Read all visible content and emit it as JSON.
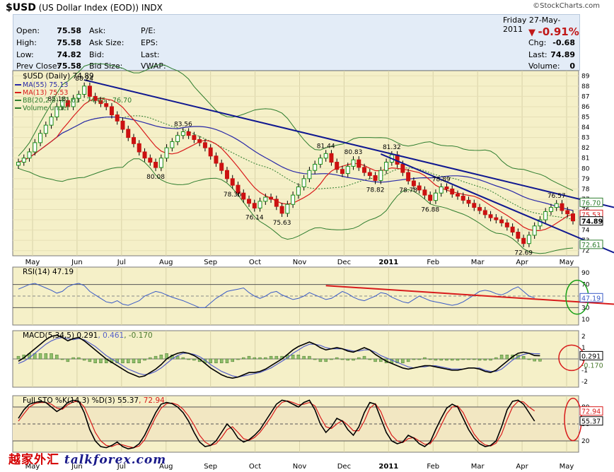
{
  "header": {
    "symbol": "$USD",
    "name": "(US Dollar Index (EOD))",
    "exchange": "INDX",
    "brand": "©StockCharts.com",
    "date": "Friday   27-May-2011",
    "change_pct": "-0.91%",
    "change_arrow": "down-triangle-icon"
  },
  "quote": {
    "left": [
      {
        "label": "Open:",
        "value": "75.58"
      },
      {
        "label": "High:",
        "value": "75.58"
      },
      {
        "label": "Low:",
        "value": "74.82"
      },
      {
        "label": "Prev Close:",
        "value": "75.58"
      }
    ],
    "mid": [
      "Ask:",
      "Ask Size:",
      "Bid:",
      "Bid Size:"
    ],
    "right_labels": [
      "P/E:",
      "EPS:",
      "Last:",
      "VWAP:"
    ],
    "far_right": [
      {
        "label": "Chg:",
        "value": "-0.68"
      },
      {
        "label": "Last:",
        "value": "74.89"
      },
      {
        "label": "Volume:",
        "value": "0"
      }
    ]
  },
  "watermark": {
    "cn": "越家外汇",
    "site": "talkforex.com"
  },
  "colors": {
    "up": "#1a8f1a",
    "down": "#cc1111",
    "ma55": "#2a2aa8",
    "ma13": "#d81b1b",
    "bb": "#2e7d2e",
    "panel": "#f5f0c8",
    "trend": "#101890",
    "rsi": "#3a5bc7"
  },
  "chart_data": [
    {
      "type": "candlestick",
      "title": "$USD (Daily) 74.89",
      "legend": [
        "MA(55) 75.13",
        "MA(13) 75.53",
        "BB(20,2.0) 72.61 - 74.65 - 76.70",
        "Volume undef"
      ],
      "x_ticks": [
        "May",
        "Jun",
        "Jul",
        "Aug",
        "Sep",
        "Oct",
        "Nov",
        "Dec",
        "2011",
        "Feb",
        "Mar",
        "Apr",
        "May"
      ],
      "y_ticks": [
        72,
        73,
        74,
        75,
        76,
        77,
        78,
        79,
        80,
        81,
        82,
        83,
        84,
        85,
        86,
        87,
        88,
        89
      ],
      "ylim": [
        71.5,
        89.5
      ],
      "close": [
        80.6,
        81.0,
        81.6,
        82.5,
        83.4,
        84.2,
        85.0,
        86.0,
        86.6,
        86.0,
        86.8,
        87.2,
        88.0,
        87.0,
        86.6,
        86.3,
        86.0,
        85.2,
        84.6,
        83.8,
        83.0,
        82.4,
        81.6,
        81.0,
        80.6,
        80.08,
        81.0,
        82.0,
        82.6,
        83.2,
        83.56,
        83.2,
        82.8,
        82.5,
        82.0,
        81.2,
        80.5,
        79.8,
        79.0,
        78.36,
        77.6,
        77.0,
        76.6,
        76.14,
        76.8,
        77.2,
        77.0,
        76.3,
        75.63,
        76.5,
        77.4,
        78.2,
        79.0,
        79.8,
        80.4,
        81.0,
        81.44,
        80.6,
        79.9,
        79.5,
        80.2,
        80.83,
        80.1,
        79.6,
        79.3,
        78.82,
        79.8,
        80.6,
        81.32,
        80.4,
        79.6,
        78.78,
        78.3,
        77.9,
        77.4,
        76.88,
        77.6,
        78.2,
        78.0,
        77.5,
        77.3,
        76.9,
        76.6,
        76.2,
        75.9,
        75.5,
        75.2,
        75.0,
        74.7,
        74.3,
        73.8,
        73.2,
        72.69,
        73.5,
        74.4,
        75.0,
        75.8,
        76.2,
        76.57,
        75.9,
        75.58,
        74.89
      ],
      "labels": [
        {
          "text": "85.13",
          "i": 7
        },
        {
          "text": "88.24",
          "i": 12
        },
        {
          "text": "80.08",
          "i": 25
        },
        {
          "text": "83.56",
          "i": 30
        },
        {
          "text": "78.36",
          "i": 39
        },
        {
          "text": "76.14",
          "i": 43
        },
        {
          "text": "75.63",
          "i": 48
        },
        {
          "text": "81.44",
          "i": 56
        },
        {
          "text": "80.83",
          "i": 61
        },
        {
          "text": "78.82",
          "i": 65
        },
        {
          "text": "78.78",
          "i": 71
        },
        {
          "text": "81.32",
          "i": 68
        },
        {
          "text": "76.88",
          "i": 75
        },
        {
          "text": "78.89",
          "i": 77
        },
        {
          "text": "72.69",
          "i": 92
        },
        {
          "text": "76.57",
          "i": 98
        }
      ],
      "right_boxes": [
        {
          "text": "76.70",
          "v": 76.7,
          "color": "#2e7d2e"
        },
        {
          "text": "75.53",
          "v": 75.53,
          "color": "#d81b1b"
        },
        {
          "text": "74.89",
          "v": 74.89,
          "color": "#000000"
        },
        {
          "text": "72.61",
          "v": 72.61,
          "color": "#2e7d2e"
        }
      ]
    },
    {
      "type": "line",
      "title": "RSI(14) 47.19",
      "y_ticks": [
        10,
        30,
        50,
        70,
        90
      ],
      "ylim": [
        0,
        100
      ],
      "value_box": "47.19",
      "values": [
        62,
        66,
        70,
        72,
        68,
        64,
        60,
        55,
        58,
        66,
        70,
        72,
        68,
        58,
        52,
        46,
        40,
        38,
        42,
        36,
        34,
        38,
        42,
        50,
        54,
        58,
        56,
        52,
        48,
        45,
        42,
        38,
        34,
        30,
        30,
        38,
        46,
        52,
        58,
        60,
        62,
        64,
        56,
        50,
        46,
        50,
        56,
        58,
        52,
        48,
        44,
        46,
        50,
        56,
        52,
        48,
        44,
        46,
        52,
        58,
        54,
        48,
        44,
        42,
        46,
        50,
        56,
        54,
        48,
        44,
        40,
        38,
        44,
        50,
        46,
        42,
        40,
        38,
        36,
        34,
        36,
        40,
        46,
        52,
        58,
        60,
        58,
        54,
        52,
        56,
        62,
        66,
        58,
        50,
        47
      ]
    },
    {
      "type": "line",
      "title": "MACD(5,34,5) 0.291, 0.461, -0.170",
      "series_names": [
        "MACD 0.291",
        "Signal 0.461",
        "Histogram -0.170"
      ],
      "y_ticks": [
        -2,
        -1,
        0,
        1,
        2
      ],
      "ylim": [
        -2.5,
        2.5
      ],
      "value_boxes": [
        "0.291",
        "-0.170"
      ],
      "macd": [
        -0.2,
        0.1,
        0.5,
        0.9,
        1.3,
        1.7,
        2.0,
        2.1,
        1.9,
        1.6,
        1.8,
        1.9,
        1.6,
        1.2,
        0.8,
        0.4,
        0.0,
        -0.3,
        -0.6,
        -0.9,
        -1.2,
        -1.4,
        -1.6,
        -1.5,
        -1.2,
        -0.9,
        -0.5,
        0.0,
        0.3,
        0.5,
        0.6,
        0.5,
        0.3,
        0.0,
        -0.4,
        -0.8,
        -1.1,
        -1.4,
        -1.6,
        -1.7,
        -1.6,
        -1.4,
        -1.2,
        -1.2,
        -1.1,
        -0.9,
        -0.6,
        -0.3,
        0.0,
        0.4,
        0.8,
        1.1,
        1.3,
        1.5,
        1.3,
        1.0,
        0.8,
        0.9,
        1.0,
        0.9,
        0.7,
        0.6,
        0.8,
        1.0,
        0.8,
        0.4,
        0.1,
        -0.2,
        -0.4,
        -0.6,
        -0.8,
        -0.9,
        -0.8,
        -0.7,
        -0.6,
        -0.6,
        -0.7,
        -0.8,
        -0.9,
        -1.0,
        -1.0,
        -0.9,
        -0.8,
        -0.8,
        -0.9,
        -1.1,
        -1.2,
        -1.0,
        -0.6,
        -0.2,
        0.2,
        0.5,
        0.6,
        0.5,
        0.3,
        0.29
      ],
      "signal": [
        -0.4,
        -0.2,
        0.1,
        0.5,
        0.9,
        1.3,
        1.6,
        1.8,
        1.9,
        1.8,
        1.7,
        1.8,
        1.7,
        1.4,
        1.1,
        0.7,
        0.3,
        0.0,
        -0.3,
        -0.6,
        -0.9,
        -1.1,
        -1.3,
        -1.4,
        -1.3,
        -1.1,
        -0.8,
        -0.4,
        0.0,
        0.3,
        0.5,
        0.5,
        0.4,
        0.2,
        -0.1,
        -0.5,
        -0.8,
        -1.1,
        -1.3,
        -1.5,
        -1.6,
        -1.5,
        -1.4,
        -1.3,
        -1.2,
        -1.0,
        -0.8,
        -0.5,
        -0.2,
        0.1,
        0.5,
        0.8,
        1.1,
        1.3,
        1.3,
        1.2,
        1.0,
        0.9,
        0.9,
        0.9,
        0.8,
        0.7,
        0.7,
        0.8,
        0.8,
        0.6,
        0.3,
        0.1,
        -0.1,
        -0.3,
        -0.5,
        -0.7,
        -0.8,
        -0.7,
        -0.7,
        -0.6,
        -0.6,
        -0.7,
        -0.8,
        -0.9,
        -0.9,
        -0.9,
        -0.8,
        -0.8,
        -0.8,
        -1.0,
        -1.1,
        -1.1,
        -0.9,
        -0.5,
        -0.1,
        0.2,
        0.4,
        0.5,
        0.46,
        0.46
      ]
    },
    {
      "type": "line",
      "title": "Full STO %K(14,3) %D(3) 55.37, 72.94",
      "series_names": [
        "%K 55.37",
        "%D 72.94"
      ],
      "y_ticks": [
        20,
        50,
        80
      ],
      "ylim": [
        0,
        100
      ],
      "value_boxes": [
        "72.94",
        "55.37"
      ],
      "k": [
        60,
        75,
        85,
        88,
        90,
        88,
        80,
        72,
        78,
        88,
        92,
        90,
        70,
        40,
        20,
        10,
        8,
        12,
        18,
        10,
        6,
        8,
        15,
        30,
        50,
        70,
        85,
        88,
        86,
        80,
        70,
        55,
        35,
        18,
        10,
        12,
        20,
        35,
        50,
        40,
        25,
        18,
        22,
        30,
        40,
        55,
        70,
        85,
        92,
        90,
        85,
        80,
        88,
        92,
        75,
        50,
        35,
        45,
        60,
        55,
        40,
        30,
        45,
        70,
        88,
        85,
        60,
        35,
        20,
        15,
        18,
        30,
        25,
        15,
        10,
        18,
        40,
        60,
        78,
        85,
        80,
        60,
        40,
        25,
        15,
        10,
        12,
        20,
        45,
        75,
        90,
        92,
        85,
        70,
        55
      ],
      "d": [
        55,
        68,
        80,
        86,
        88,
        88,
        85,
        78,
        76,
        84,
        89,
        90,
        80,
        58,
        35,
        20,
        12,
        10,
        14,
        13,
        10,
        8,
        11,
        22,
        42,
        62,
        78,
        86,
        87,
        84,
        76,
        64,
        48,
        30,
        18,
        12,
        15,
        26,
        40,
        45,
        35,
        24,
        21,
        26,
        35,
        48,
        62,
        78,
        88,
        91,
        88,
        84,
        85,
        88,
        82,
        62,
        45,
        42,
        50,
        56,
        48,
        38,
        38,
        55,
        78,
        86,
        72,
        48,
        30,
        20,
        17,
        24,
        26,
        20,
        14,
        15,
        28,
        48,
        68,
        80,
        82,
        70,
        50,
        32,
        20,
        13,
        11,
        16,
        32,
        58,
        80,
        90,
        89,
        80,
        73
      ]
    }
  ]
}
